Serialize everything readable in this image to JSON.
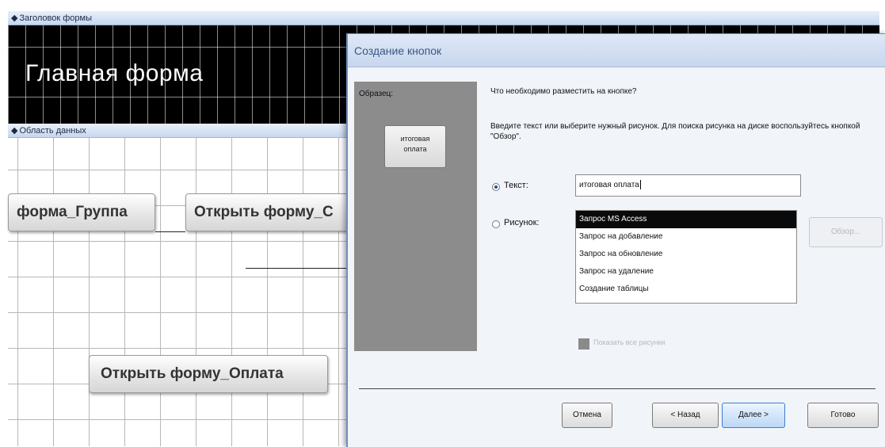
{
  "designer": {
    "header_section": "Заголовок формы",
    "form_title": "Главная форма",
    "data_section": "Область данных",
    "buttons": [
      "форма_Группа",
      "Открыть форму_С",
      "Открыть форму_Оплата"
    ]
  },
  "dialog": {
    "title": "Создание кнопок",
    "preview_label": "Образец:",
    "preview_button_lines": [
      "итоговая",
      "оплата"
    ],
    "question": "Что необходимо разместить на кнопке?",
    "instructions": "Введите текст или выберите нужный рисунок.  Для поиска рисунка на диске воспользуйтесь кнопкой \"Обзор\".",
    "text_option_label": "Текст:",
    "text_value": "итоговая оплата",
    "picture_option_label": "Рисунок:",
    "selected_option": "text",
    "picture_list": [
      "Запрос MS Access",
      "Запрос на добавление",
      "Запрос на обновление",
      "Запрос на удаление",
      "Создание таблицы"
    ],
    "picture_selected": "Запрос MS Access",
    "browse_label": "Обзор...",
    "show_all_label": "Показать все рисунки",
    "cancel_label": "Отмена",
    "back_label": "< Назад",
    "next_label": "Далее >",
    "finish_label": "Готово"
  }
}
